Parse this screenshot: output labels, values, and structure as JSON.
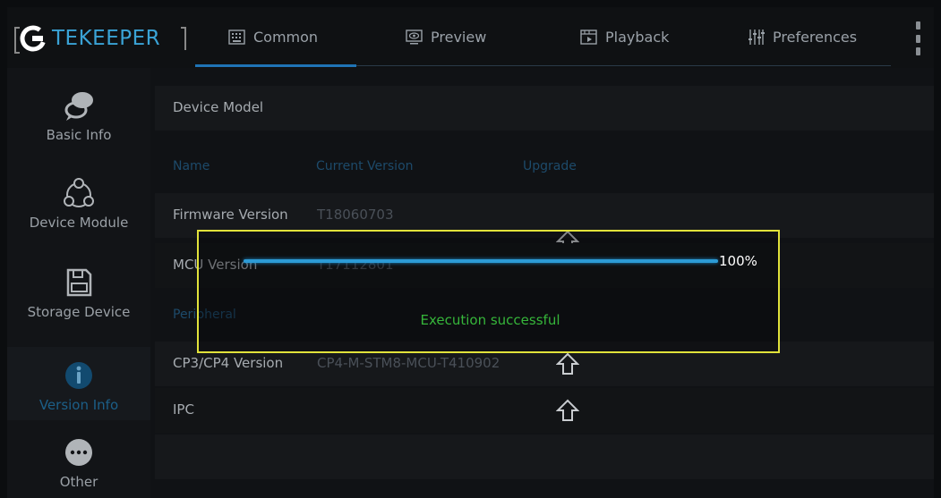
{
  "header": {
    "logo_mark": "G",
    "logo_text_dim": "",
    "logo_text": "TEKEEPER",
    "tabs": [
      {
        "label": "Common",
        "icon": "keyboard-icon"
      },
      {
        "label": "Preview",
        "icon": "monitor-eye-icon"
      },
      {
        "label": "Playback",
        "icon": "film-play-icon"
      },
      {
        "label": "Preferences",
        "icon": "sliders-icon"
      }
    ],
    "active_tab": "Common"
  },
  "sidebar": {
    "items": [
      {
        "label": "Basic Info",
        "icon": "chat-bubbles-icon"
      },
      {
        "label": "Device Module",
        "icon": "modules-icon"
      },
      {
        "label": "Storage Device",
        "icon": "floppy-icon"
      },
      {
        "label": "Version Info",
        "icon": "info-icon",
        "active": true
      },
      {
        "label": "Other",
        "icon": "more-icon"
      }
    ]
  },
  "content": {
    "device_model_label": "Device Model",
    "columns": [
      "Name",
      "Current Version",
      "Upgrade"
    ],
    "firmware": {
      "label": "Firmware Version",
      "version": "T18060703"
    },
    "mcu": {
      "label": "MCU Version",
      "version": "T17112801"
    },
    "peripheral_label": "Peripheral",
    "cp": {
      "label": "CP3/CP4 Version",
      "version": "CP4-M-STM8-MCU-T410902"
    },
    "ipc": {
      "label": "IPC"
    }
  },
  "dialog": {
    "progress": 1.0,
    "progress_label": "100%",
    "message": "Execution successful"
  },
  "colors": {
    "accent": "#2c9bd6",
    "active_label": "#1c5f88",
    "success": "#36b53a",
    "dialog_border": "#e1e23a"
  }
}
